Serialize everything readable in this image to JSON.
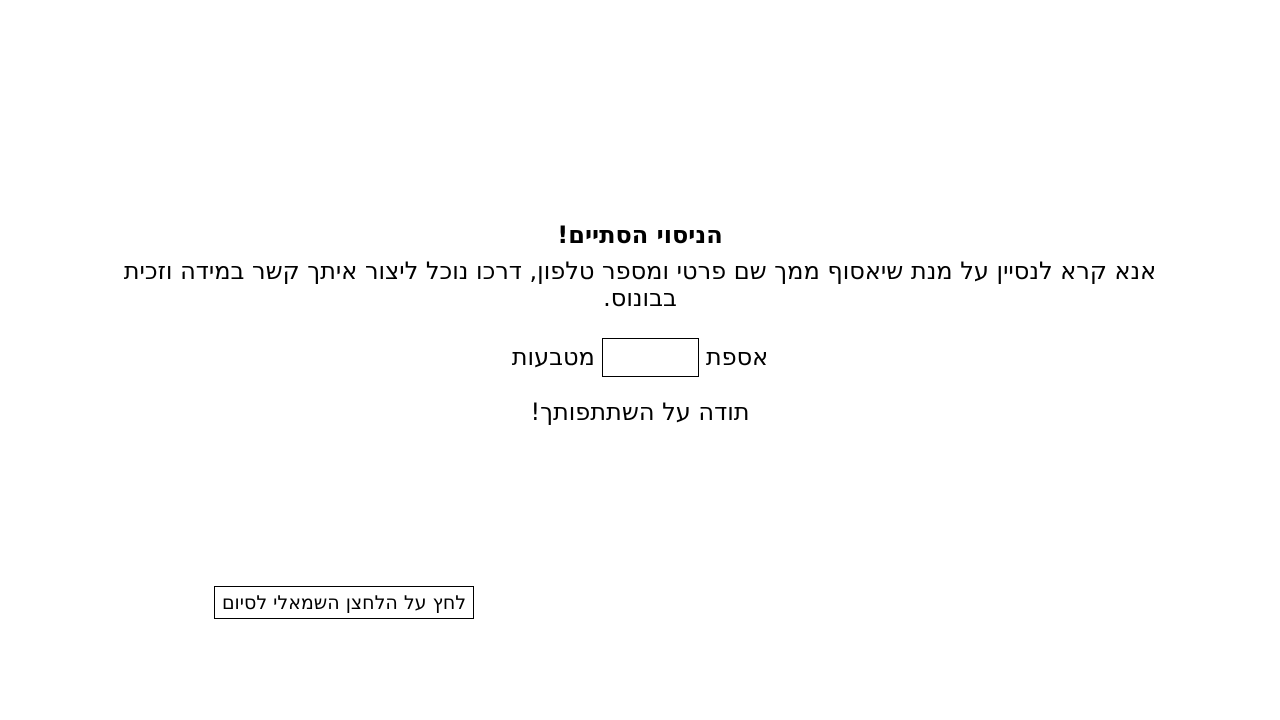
{
  "main": {
    "title": "הניסוי הסתיים!",
    "message": "אנא קרא לנסיין על מנת שיאסוף ממך שם פרטי ומספר טלפון, דרכו נוכל ליצור איתך קשר במידה וזכית בבונוס.",
    "collected_prefix": "אספת",
    "coins_input_value": "",
    "collected_suffix": "מטבעות",
    "thanks": "תודה על השתתפותך!"
  },
  "footer": {
    "finish_button_label": "לחץ על הלחצן השמאלי לסיום"
  }
}
